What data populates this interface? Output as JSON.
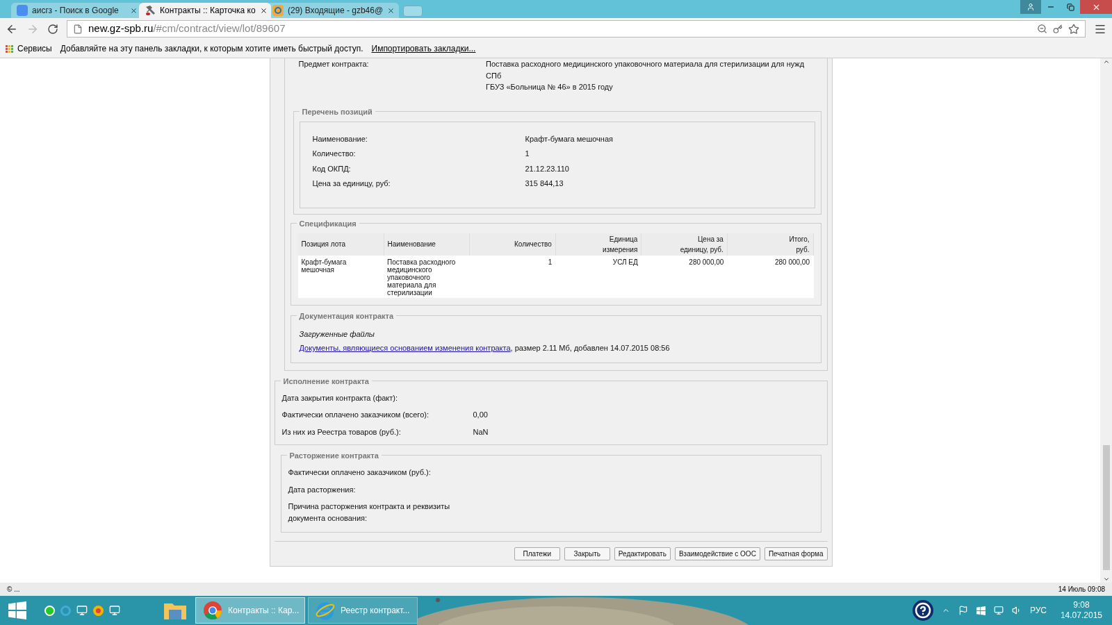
{
  "browser": {
    "tabs": [
      {
        "title": "аисгз - Поиск в Google",
        "selected": false
      },
      {
        "title": "Контракты :: Карточка ко",
        "selected": true
      },
      {
        "title": "(29) Входящие - gzb46@",
        "selected": false
      }
    ],
    "url_host": "new.gz-spb.ru",
    "url_path": "/#cm/contract/view/lot/89607",
    "bookmarks": {
      "apps": "Сервисы",
      "hint": "Добавляйте на эту панель закладки, к которым хотите иметь быстрый доступ.",
      "import_link": "Импортировать закладки..."
    }
  },
  "subject": {
    "label": "Предмет контракта:",
    "value_lines": [
      "Поставка расходного медицинского упаковочного материала для стерилизации для нужд СПб",
      "ГБУЗ «Больница № 46» в 2015 году"
    ]
  },
  "positions": {
    "legend": "Перечень позиций",
    "fields": [
      {
        "label": "Наименование:",
        "value": "Крафт-бумага мешочная"
      },
      {
        "label": "Количество:",
        "value": "1"
      },
      {
        "label": "Код ОКПД:",
        "value": "21.12.23.110"
      },
      {
        "label": "Цена за единицу, руб:",
        "value": "315 844,13"
      }
    ]
  },
  "specification": {
    "legend": "Спецификация",
    "columns": [
      {
        "lines": [
          "Позиция лота"
        ]
      },
      {
        "lines": [
          "Наименование"
        ]
      },
      {
        "lines": [
          "Количество"
        ]
      },
      {
        "lines": [
          "Единица",
          "измерения"
        ]
      },
      {
        "lines": [
          "Цена за",
          "единицу, руб."
        ]
      },
      {
        "lines": [
          "Итого,",
          "руб."
        ]
      }
    ],
    "rows": [
      [
        "Крафт-бумага мешочная",
        "Поставка расходного медицинского упаковочного материала для стерилизации",
        "1",
        "УСЛ ЕД",
        "280 000,00",
        "280 000,00"
      ]
    ]
  },
  "documents": {
    "legend": "Документация контракта",
    "subtitle": "Загруженные файлы",
    "link": "Документы, являющиеся основанием изменения контракта",
    "details": ", размер 2.11 Мб, добавлен 14.07.2015 08:56"
  },
  "execution": {
    "legend": "Исполнение контракта",
    "fields": [
      {
        "label": "Дата закрытия контракта (факт):"
      },
      {
        "label": "Фактически оплачено заказчиком (всего):",
        "value": "0,00"
      },
      {
        "label": "Из них из Реестра товаров (руб.):",
        "value": "NaN"
      }
    ]
  },
  "termination": {
    "legend": "Расторжение контракта",
    "fields": [
      {
        "label": "Фактически оплачено заказчиком (руб.):"
      },
      {
        "label": "Дата расторжения:"
      },
      {
        "label": "Причина расторжения контракта и реквизиты документа основания:"
      }
    ]
  },
  "buttons": [
    "Платежи",
    "Закрыть",
    "Редактировать",
    "Взаимодействие с ООС",
    "Печатная форма"
  ],
  "status_bar": {
    "left": "© ...",
    "right": "14 Июль 09:08"
  },
  "taskbar": {
    "windows": [
      {
        "title": "Контракты :: Кар...",
        "selected": true
      },
      {
        "title": "Реестр контракт...",
        "selected": false
      }
    ],
    "language": "РУС",
    "time": "9:08",
    "date": "14.07.2015"
  }
}
